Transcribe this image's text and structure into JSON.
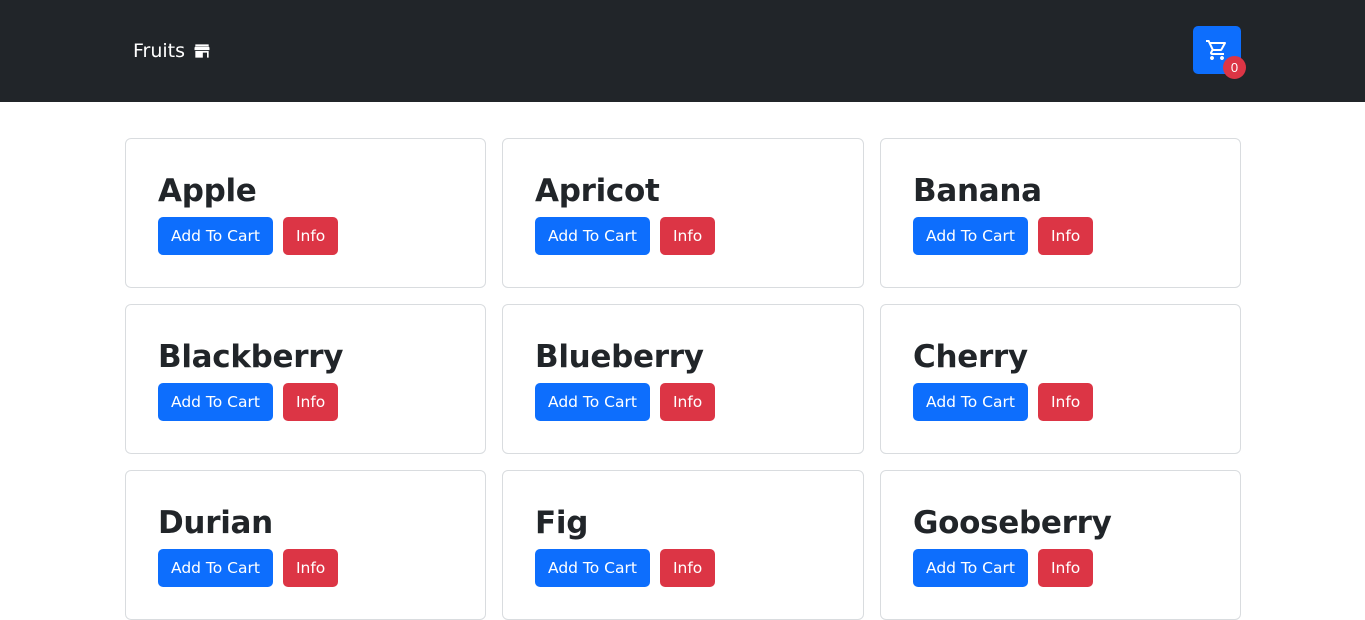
{
  "navbar": {
    "brand_label": "Fruits",
    "brand_icon": "store-icon",
    "cart_icon": "cart-icon",
    "cart_count": "0"
  },
  "colors": {
    "navbar_bg": "#212529",
    "primary": "#0d6efd",
    "danger": "#dc3545"
  },
  "products": [
    {
      "name": "Apple",
      "add_label": "Add To Cart",
      "info_label": "Info"
    },
    {
      "name": "Apricot",
      "add_label": "Add To Cart",
      "info_label": "Info"
    },
    {
      "name": "Banana",
      "add_label": "Add To Cart",
      "info_label": "Info"
    },
    {
      "name": "Blackberry",
      "add_label": "Add To Cart",
      "info_label": "Info"
    },
    {
      "name": "Blueberry",
      "add_label": "Add To Cart",
      "info_label": "Info"
    },
    {
      "name": "Cherry",
      "add_label": "Add To Cart",
      "info_label": "Info"
    },
    {
      "name": "Durian",
      "add_label": "Add To Cart",
      "info_label": "Info"
    },
    {
      "name": "Fig",
      "add_label": "Add To Cart",
      "info_label": "Info"
    },
    {
      "name": "Gooseberry",
      "add_label": "Add To Cart",
      "info_label": "Info"
    }
  ]
}
